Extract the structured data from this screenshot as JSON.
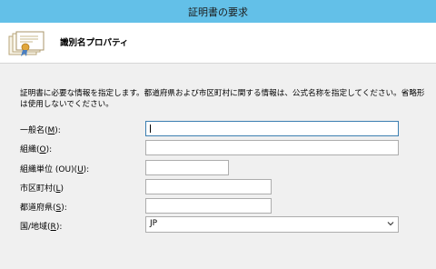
{
  "window": {
    "title": "証明書の要求"
  },
  "header": {
    "title": "識別名プロパティ",
    "icon": "certificate-stack-icon"
  },
  "description": "証明書に必要な情報を指定します。都道府県および市区町村に関する情報は、公式名称を指定してください。省略形は使用しないでください。",
  "fields": [
    {
      "label_pre": "一般名(",
      "accel": "M",
      "label_post": "):",
      "value": "",
      "placeholder": ""
    },
    {
      "label_pre": "組織(",
      "accel": "O",
      "label_post": "):",
      "value": "",
      "placeholder": ""
    },
    {
      "label_pre": "組織単位 (OU)(",
      "accel": "U",
      "label_post": "):",
      "value": "",
      "placeholder": ""
    },
    {
      "label_pre": "市区町村(",
      "accel": "L",
      "label_post": ")",
      "value": "",
      "placeholder": ""
    },
    {
      "label_pre": "都道府県(",
      "accel": "S",
      "label_post": "):",
      "value": "",
      "placeholder": ""
    },
    {
      "label_pre": "国/地域(",
      "accel": "R",
      "label_post": "):",
      "value": "JP",
      "placeholder": ""
    }
  ],
  "colors": {
    "titlebar": "#63c0e8",
    "focus_border": "#3c7fb1",
    "input_border": "#adadad",
    "window_bg": "#f0f0f0"
  }
}
